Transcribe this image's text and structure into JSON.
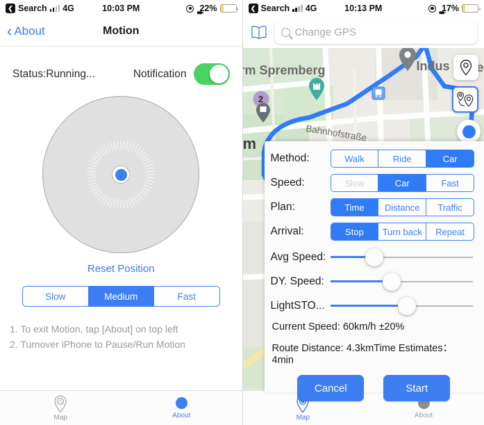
{
  "left": {
    "status_bar": {
      "carrier_back": "Search",
      "network": "4G",
      "time": "10:03 PM",
      "battery": "22%"
    },
    "nav": {
      "back_label": "About",
      "title": "Motion"
    },
    "status_label": "Status:Running...",
    "notification_label": "Notification",
    "notification_on": true,
    "reset_label": "Reset Position",
    "speed_segments": [
      {
        "label": "Slow",
        "selected": false
      },
      {
        "label": "Medium",
        "selected": true
      },
      {
        "label": "Fast",
        "selected": false
      }
    ],
    "notes": [
      "1. To exit Motion, tap [About] on top left",
      "2. Turnover iPhone to Pause/Run Motion"
    ],
    "tabs": [
      {
        "label": "Map",
        "active": false
      },
      {
        "label": "About",
        "active": true
      }
    ]
  },
  "right": {
    "status_bar": {
      "carrier_back": "Search",
      "network": "4G",
      "time": "10:13 PM",
      "battery": "17%"
    },
    "search": {
      "placeholder": "Change GPS",
      "value": ""
    },
    "map": {
      "labels": [
        {
          "text": "rm Spremberg"
        },
        {
          "text": "Indus"
        },
        {
          "text": "Bahnhofstraße"
        },
        {
          "text": "m"
        },
        {
          "text": "e"
        }
      ],
      "marker_number": "2"
    },
    "rows": [
      {
        "label": "Method:",
        "options": [
          {
            "label": "Walk",
            "selected": false,
            "faded": false
          },
          {
            "label": "Ride",
            "selected": false,
            "faded": false
          },
          {
            "label": "Car",
            "selected": true,
            "faded": false
          }
        ]
      },
      {
        "label": "Speed:",
        "options": [
          {
            "label": "Slow",
            "selected": false,
            "faded": true
          },
          {
            "label": "Car",
            "selected": true,
            "faded": false
          },
          {
            "label": "Fast",
            "selected": false,
            "faded": false
          }
        ]
      },
      {
        "label": "Plan:",
        "options": [
          {
            "label": "Time",
            "selected": true,
            "faded": false
          },
          {
            "label": "Distance",
            "selected": false,
            "faded": false
          },
          {
            "label": "Traffic",
            "selected": false,
            "faded": false
          }
        ]
      },
      {
        "label": "Arrival:",
        "options": [
          {
            "label": "Stop",
            "selected": true,
            "faded": false
          },
          {
            "label": "Turn back",
            "selected": false,
            "faded": false
          },
          {
            "label": "Repeat",
            "selected": false,
            "faded": false
          }
        ]
      }
    ],
    "sliders": [
      {
        "label": "Avg Speed:",
        "percent": 31
      },
      {
        "label": "DY. Speed:",
        "percent": 43
      },
      {
        "label": "LightSTO...",
        "percent": 54
      }
    ],
    "info_current_speed": "Current Speed: 60km/h ±20%",
    "info_route": "Route Distance: 4.3kmTime Estimates： 4min",
    "buttons": {
      "cancel": "Cancel",
      "start": "Start"
    },
    "tabs": [
      {
        "label": "Map",
        "active": true
      },
      {
        "label": "About",
        "active": false
      }
    ]
  },
  "colors": {
    "accent": "#3d7ff2",
    "toggle_on": "#4cd164",
    "battery": "#fcd95b"
  }
}
